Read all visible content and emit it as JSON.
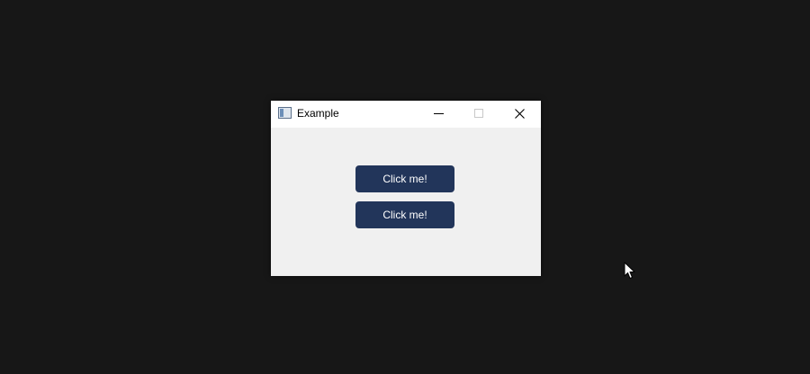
{
  "window": {
    "title": "Example",
    "icon": "app-window-icon",
    "caption_buttons": [
      "minimize-icon",
      "maximize-icon",
      "close-icon"
    ]
  },
  "content": {
    "buttons": [
      {
        "label": "Click me!"
      },
      {
        "label": "Click me!"
      }
    ]
  },
  "colors": {
    "desktop_background": "#171717",
    "window_background": "#f0f0f0",
    "titlebar_background": "#ffffff",
    "button_background": "#22355a",
    "button_text": "#ffffff"
  },
  "cursor": {
    "icon": "mouse-pointer-icon"
  }
}
